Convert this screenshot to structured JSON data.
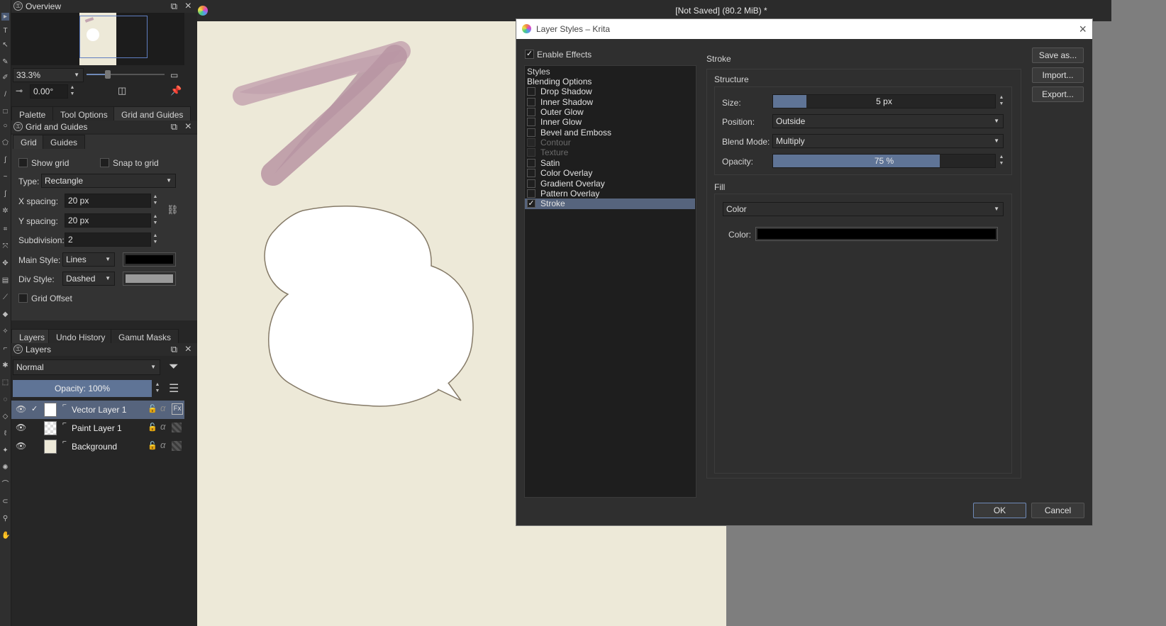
{
  "overview": {
    "title": "Overview",
    "zoom": "33.3%",
    "rotation": "0.00°"
  },
  "docker_tabs": [
    "Palette",
    "Tool Options",
    "Grid and Guides"
  ],
  "grid_guides": {
    "title": "Grid and Guides",
    "tabs": [
      "Grid",
      "Guides"
    ],
    "show_grid": "Show grid",
    "snap_to_grid": "Snap to grid",
    "type_label": "Type:",
    "type_value": "Rectangle",
    "x_spacing_label": "X spacing:",
    "x_spacing": "20 px",
    "y_spacing_label": "Y spacing:",
    "y_spacing": "20 px",
    "subdivision_label": "Subdivision:",
    "subdivision": "2",
    "main_style_label": "Main Style:",
    "main_style": "Lines",
    "main_color": "#000000",
    "div_style_label": "Div Style:",
    "div_style": "Dashed",
    "div_color": "#9a9a9a",
    "grid_offset": "Grid Offset"
  },
  "bottom_tabs": [
    "Layers",
    "Undo History",
    "Gamut Masks"
  ],
  "layers": {
    "title": "Layers",
    "blend_mode": "Normal",
    "opacity": "Opacity:  100%",
    "items": [
      {
        "name": "Vector Layer 1",
        "selected": true
      },
      {
        "name": "Paint Layer 1",
        "selected": false
      },
      {
        "name": "Background",
        "selected": false
      }
    ]
  },
  "document": {
    "title": "[Not Saved]  (80.2 MiB) *"
  },
  "dialog": {
    "title": "Layer Styles – Krita",
    "enable_effects": "Enable Effects",
    "styles_header": "Styles",
    "style_list": [
      {
        "label": "Blending Options",
        "checkbox": false,
        "checked": false,
        "disabled": false
      },
      {
        "label": "Drop Shadow",
        "checkbox": true,
        "checked": false,
        "disabled": false
      },
      {
        "label": "Inner Shadow",
        "checkbox": true,
        "checked": false,
        "disabled": false
      },
      {
        "label": "Outer Glow",
        "checkbox": true,
        "checked": false,
        "disabled": false
      },
      {
        "label": "Inner Glow",
        "checkbox": true,
        "checked": false,
        "disabled": false
      },
      {
        "label": "Bevel and Emboss",
        "checkbox": true,
        "checked": false,
        "disabled": false
      },
      {
        "label": "Contour",
        "checkbox": true,
        "checked": false,
        "disabled": true
      },
      {
        "label": "Texture",
        "checkbox": true,
        "checked": false,
        "disabled": true
      },
      {
        "label": "Satin",
        "checkbox": true,
        "checked": false,
        "disabled": false
      },
      {
        "label": "Color Overlay",
        "checkbox": true,
        "checked": false,
        "disabled": false
      },
      {
        "label": "Gradient Overlay",
        "checkbox": true,
        "checked": false,
        "disabled": false
      },
      {
        "label": "Pattern Overlay",
        "checkbox": true,
        "checked": false,
        "disabled": false
      },
      {
        "label": "Stroke",
        "checkbox": true,
        "checked": true,
        "disabled": false
      }
    ],
    "section_title": "Stroke",
    "structure": {
      "title": "Structure",
      "size_label": "Size:",
      "size_value": "5 px",
      "size_fraction": 0.15,
      "position_label": "Position:",
      "position_value": "Outside",
      "blend_label": "Blend Mode:",
      "blend_value": "Multiply",
      "opacity_label": "Opacity:",
      "opacity_value": "75 %",
      "opacity_fraction": 0.75
    },
    "fill": {
      "title": "Fill",
      "type": "Color",
      "color_label": "Color:",
      "color": "#000000"
    },
    "buttons": {
      "save_as": "Save as...",
      "import": "Import...",
      "export": "Export...",
      "ok": "OK",
      "cancel": "Cancel"
    }
  }
}
